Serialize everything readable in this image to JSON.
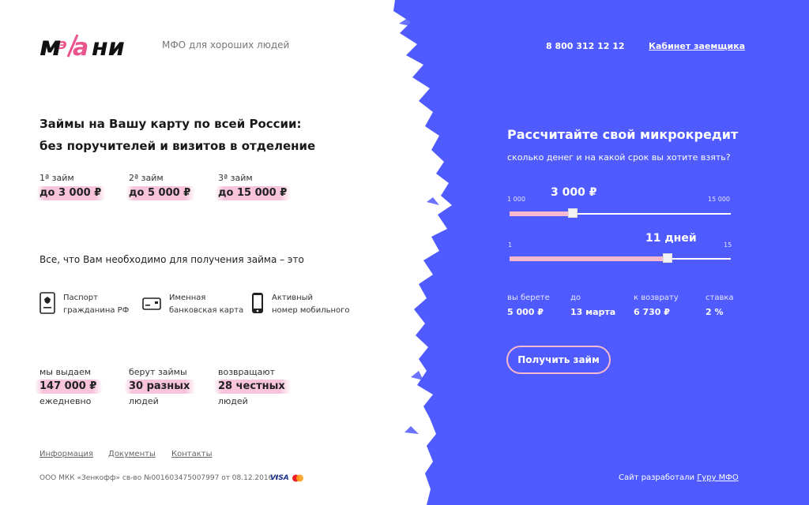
{
  "colors": {
    "accent_blue": "#4f5bff",
    "highlight_pink": "#f6b9d0",
    "logo_pink": "#e8558d",
    "text_dark": "#222222"
  },
  "brand": {
    "logo_text": "мэйани",
    "tagline": "МФО для хороших людей"
  },
  "header": {
    "phone": "8 800 312 12 12",
    "cabinet_link": "Кабинет заемщика"
  },
  "hero": {
    "line1": "Займы на Вашу карту по всей России:",
    "line2": "без поручителей и визитов в отделение"
  },
  "loans": [
    {
      "label": "1ª займ",
      "amount": "до 3 000 ₽"
    },
    {
      "label": "2ª займ",
      "amount": "до 5 000 ₽"
    },
    {
      "label": "3ª займ",
      "amount": "до 15 000 ₽"
    }
  ],
  "needs": {
    "title": "Все, что Вам необходимо для получения займа – это",
    "items": [
      {
        "icon": "passport-icon",
        "line1": "Паспорт",
        "line2": "гражданина РФ"
      },
      {
        "icon": "bank-card-icon",
        "line1": "Именная",
        "line2": "банковская карта"
      },
      {
        "icon": "mobile-phone-icon",
        "line1": "Активный",
        "line2": "номер мобильного"
      }
    ]
  },
  "stats": [
    {
      "top": "мы выдаем",
      "value": "147 000 ₽",
      "bottom": "ежедневно"
    },
    {
      "top": "берут займы",
      "value": "30 разных",
      "bottom": "людей"
    },
    {
      "top": "возвращают",
      "value": "28 честных",
      "bottom": "людей"
    }
  ],
  "footer": {
    "links": [
      "Информация",
      "Документы",
      "Контакты"
    ],
    "legal": "ООО МКК «Зенкофф» св-во №001603475007997 от 08.12.2016 г.",
    "visa": "VISA",
    "credit_prefix": "Сайт разработали",
    "credit_link": "Гуру МФО"
  },
  "calculator": {
    "title": "Рассчитайте свой микрокредит",
    "subtitle": "сколько денег и на какой срок вы хотите взять?",
    "amount_slider": {
      "min_label": "1 000",
      "max_label": "15 000",
      "min": 1000,
      "max": 15000,
      "value": 5000,
      "value_label": "3 000 ₽"
    },
    "days_slider": {
      "min_label": "1",
      "max_label": "15",
      "min": 1,
      "max": 15,
      "value": 11,
      "value_label": "11 дней"
    },
    "summary": [
      {
        "key": "вы берете",
        "value": "5 000 ₽"
      },
      {
        "key": "до",
        "value": "13 марта"
      },
      {
        "key": "к возврату",
        "value": "6 730 ₽"
      },
      {
        "key": "ставка",
        "value": "2 %"
      }
    ],
    "cta": "Получить займ"
  }
}
